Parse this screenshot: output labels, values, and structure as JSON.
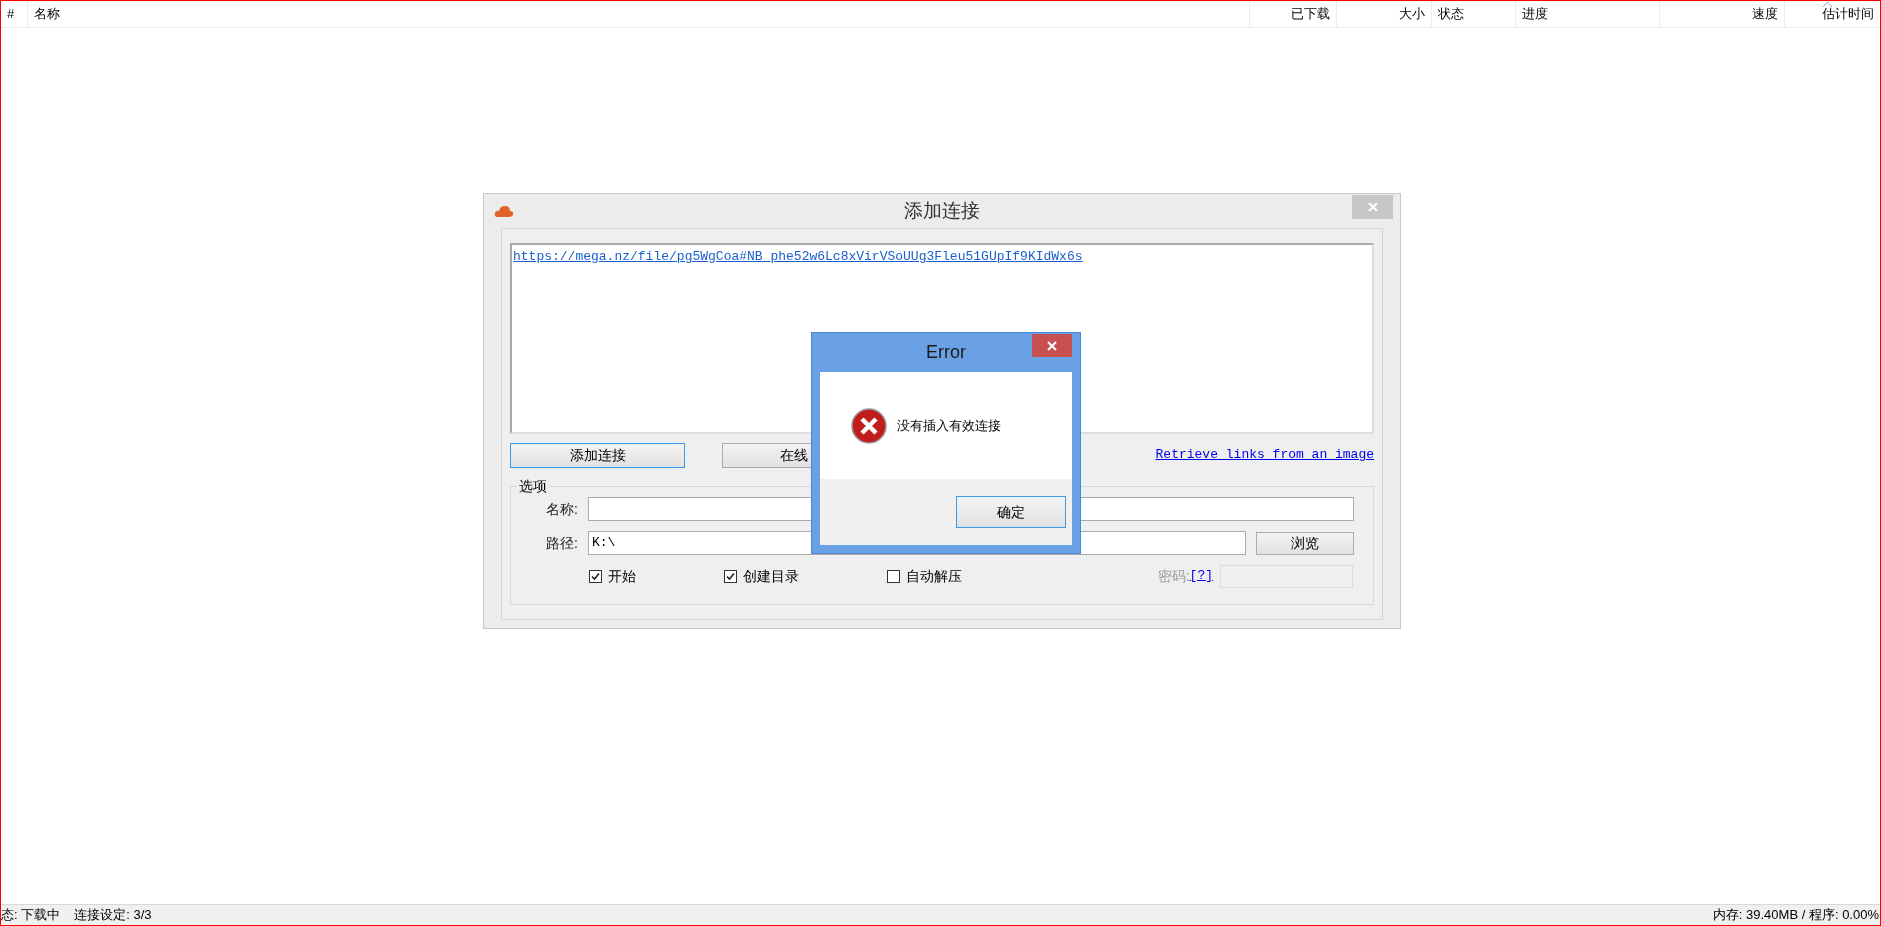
{
  "table": {
    "columns": [
      {
        "label": "#",
        "sorted": false
      },
      {
        "label": "名称",
        "sorted": false
      },
      {
        "label": "已下载",
        "sorted": false
      },
      {
        "label": "大小",
        "sorted": false
      },
      {
        "label": "状态",
        "sorted": false
      },
      {
        "label": "进度",
        "sorted": false
      },
      {
        "label": "速度",
        "sorted": false
      },
      {
        "label": "估计时间",
        "sorted": true
      }
    ]
  },
  "add_dialog": {
    "title": "添加连接",
    "links_text": "https://mega.nz/file/pg5WgCoa#NB_phe52w6Lc8xVirVSoUUg3Fleu51GUpIf9KIdWx6s",
    "buttons": [
      "添加连接",
      "在线"
    ],
    "image_link": "Retrieve links from an image",
    "options": {
      "title": "选项",
      "name_label": "名称:",
      "path_label": "路径:",
      "path_value": "K:\\",
      "browse": "浏览",
      "checkboxes": [
        {
          "label": "开始",
          "checked": true
        },
        {
          "label": "创建目录",
          "checked": true
        },
        {
          "label": "自动解压",
          "checked": false
        }
      ],
      "password_label": "密码:",
      "password_help": "[?]"
    }
  },
  "error_dialog": {
    "title": "Error",
    "message": "没有插入有效连接",
    "ok": "确定"
  },
  "status_bar": {
    "left": [
      "态: 下载中",
      "连接设定: 3/3"
    ],
    "right": "内存: 39.40MB / 程序: 0.00%"
  }
}
